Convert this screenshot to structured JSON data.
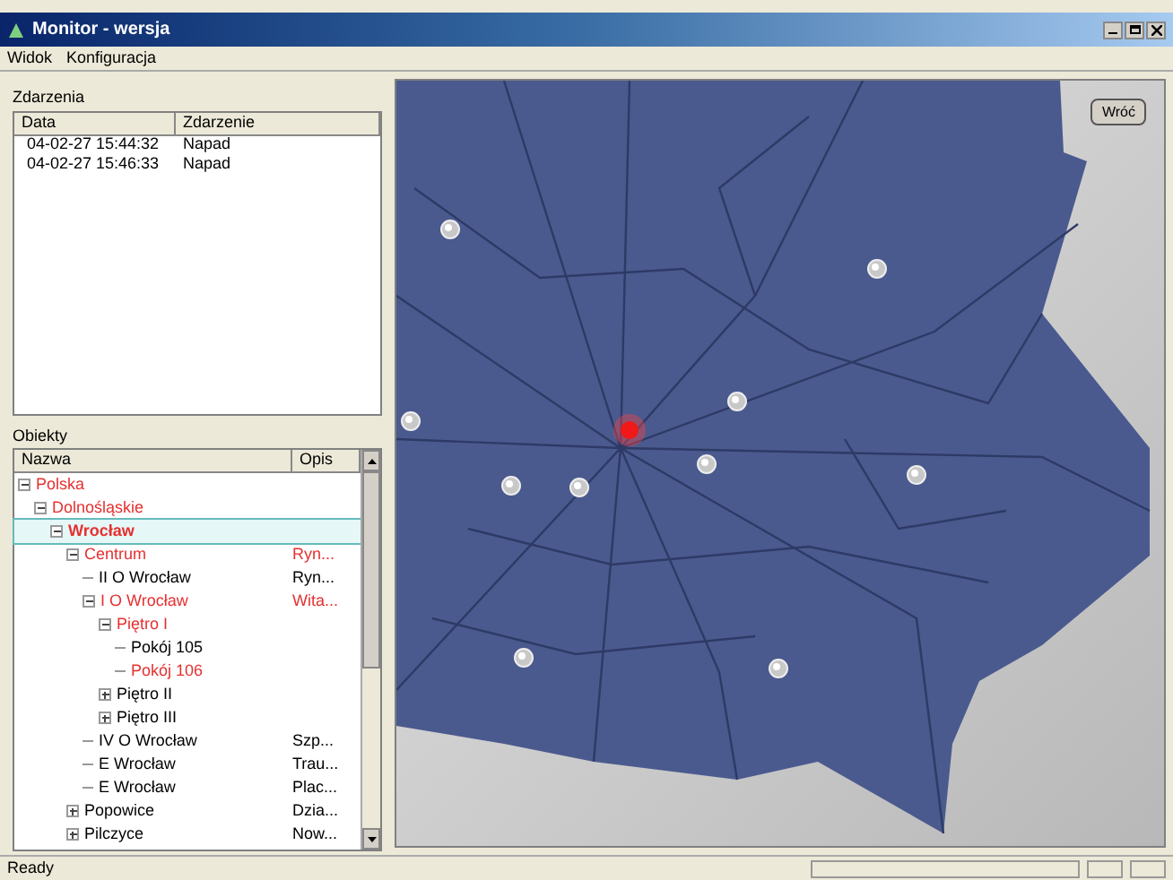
{
  "window": {
    "title": "Monitor - wersja"
  },
  "menu": [
    "Widok",
    "Konfiguracja"
  ],
  "events": {
    "title": "Zdarzenia",
    "columns": [
      "Data",
      "Zdarzenie"
    ],
    "rows": [
      {
        "date": "04-02-27 15:44:32",
        "event": "Napad"
      },
      {
        "date": "04-02-27 15:46:33",
        "event": "Napad"
      }
    ]
  },
  "objects": {
    "title": "Obiekty",
    "columns": [
      "Nazwa",
      "Opis"
    ],
    "tree": [
      {
        "name": "Polska",
        "alarm": true,
        "selected": false,
        "expanded": true,
        "children": [
          {
            "name": "Dolnośląskie",
            "alarm": true,
            "selected": false,
            "expanded": true,
            "children": [
              {
                "name": "Wrocław",
                "alarm": true,
                "selected": true,
                "expanded": true,
                "children": [
                  {
                    "name": "Centrum",
                    "description": "Ryn...",
                    "alarm": true,
                    "selected": false,
                    "expanded": true,
                    "children": [
                      {
                        "name": "II O Wrocław",
                        "description": "Ryn...",
                        "alarm": false,
                        "selected": false
                      },
                      {
                        "name": "I O Wrocław",
                        "description": "Wita...",
                        "alarm": true,
                        "selected": false,
                        "expanded": true,
                        "children": [
                          {
                            "name": "Piętro I",
                            "alarm": true,
                            "selected": false,
                            "expanded": true,
                            "children": [
                              {
                                "name": "Pokój 105",
                                "alarm": false,
                                "selected": false
                              },
                              {
                                "name": "Pokój 106",
                                "alarm": true,
                                "selected": false
                              }
                            ]
                          },
                          {
                            "name": "Piętro II",
                            "alarm": false,
                            "selected": false,
                            "expanded": false
                          },
                          {
                            "name": "Piętro III",
                            "alarm": false,
                            "selected": false,
                            "expanded": false
                          }
                        ]
                      },
                      {
                        "name": "IV O Wrocław",
                        "description": "Szp...",
                        "alarm": false,
                        "selected": false
                      },
                      {
                        "name": "E Wrocław",
                        "description": "Trau...",
                        "alarm": false,
                        "selected": false
                      },
                      {
                        "name": "E Wrocław",
                        "description": "Plac...",
                        "alarm": false,
                        "selected": false
                      }
                    ]
                  },
                  {
                    "name": "Popowice",
                    "description": "Dzia...",
                    "alarm": false,
                    "selected": false,
                    "expanded": false
                  },
                  {
                    "name": "Pilczyce",
                    "description": "Now...",
                    "alarm": false,
                    "selected": false,
                    "expanded": false
                  }
                ]
              }
            ]
          }
        ]
      }
    ]
  },
  "map": {
    "button": "Wróć"
  },
  "status_bar": {
    "text": "Ready"
  }
}
